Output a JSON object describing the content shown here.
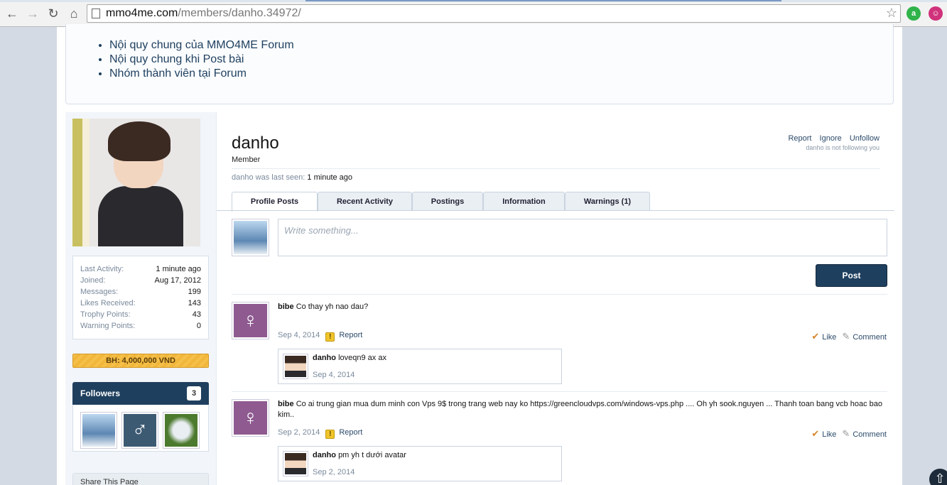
{
  "browser": {
    "url_host": "mmo4me.com",
    "url_path": "/members/danho.34972/"
  },
  "notice": {
    "items": [
      "Nội quy chung của MMO4ME Forum",
      "Nội quy chung khi Post bài",
      "Nhóm thành viên tại Forum"
    ]
  },
  "sidebar": {
    "stats": [
      {
        "label": "Last Activity:",
        "value": "1 minute ago"
      },
      {
        "label": "Joined:",
        "value": "Aug 17, 2012"
      },
      {
        "label": "Messages:",
        "value": "199"
      },
      {
        "label": "Likes Received:",
        "value": "143"
      },
      {
        "label": "Trophy Points:",
        "value": "43"
      },
      {
        "label": "Warning Points:",
        "value": "0"
      }
    ],
    "bh_label": "BH: 4,000,000 VND",
    "followers_title": "Followers",
    "followers_count": "3",
    "share_title": "Share This Page"
  },
  "profile": {
    "username": "danho",
    "title": "Member",
    "links": {
      "report": "Report",
      "ignore": "Ignore",
      "unfollow": "Unfollow"
    },
    "following_note": "danho is not following you",
    "last_seen_label": "danho was last seen:",
    "last_seen_value": "1 minute ago",
    "tabs": [
      "Profile Posts",
      "Recent Activity",
      "Postings",
      "Information",
      "Warnings (1)"
    ],
    "composer_placeholder": "Write something...",
    "post_button": "Post"
  },
  "posts": [
    {
      "author": "bibe",
      "text": "Co thay yh nao dau?",
      "date": "Sep 4, 2014",
      "report": "Report",
      "like": "Like",
      "comment": "Comment",
      "reply": {
        "author": "danho",
        "text": "loveqn9 ax ax",
        "date": "Sep 4, 2014"
      }
    },
    {
      "author": "bibe",
      "text": "Co ai trung gian mua dum minh con Vps 9$ trong trang web nay ko https://greencloudvps.com/windows-vps.php .... Oh yh sook.nguyen ... Thanh toan bang vcb hoac bao kim..",
      "date": "Sep 2, 2014",
      "report": "Report",
      "like": "Like",
      "comment": "Comment",
      "reply": {
        "author": "danho",
        "text": "pm yh t dưới avatar",
        "date": "Sep 2, 2014"
      }
    }
  ]
}
